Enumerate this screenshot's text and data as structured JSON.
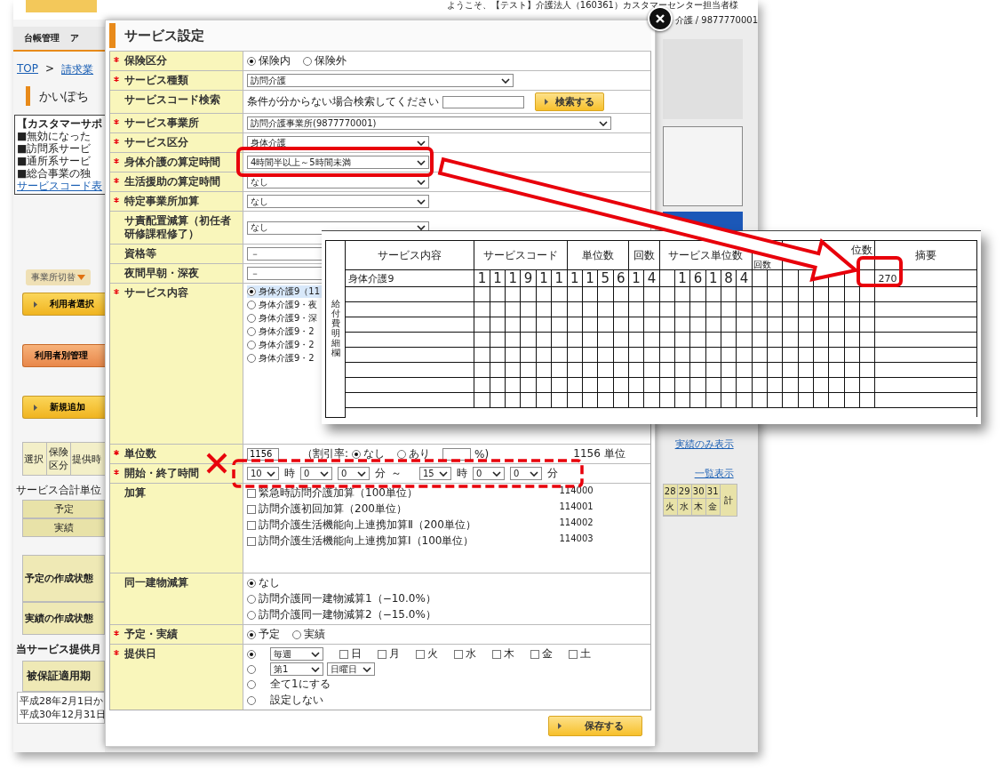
{
  "background": {
    "welcome": "ようこそ、【テスト】介護法人（160361）カスタマーセンター担当者様",
    "account": "介護 / 9877770001",
    "nav_tabs": [
      "台帳管理",
      "ア"
    ],
    "breadcrumb": [
      "TOP",
      "請求業"
    ],
    "breadcrumb_separator": ">",
    "page_title": "かいぽち",
    "notice": {
      "title": "【カスタマーサポ",
      "lines": [
        "■無効になった",
        "■訪問系サービ",
        "■通所系サービ",
        "■総合事業の独"
      ],
      "link": "サービスコード表"
    },
    "office_switch": "事業所切替",
    "buttons": [
      {
        "label": "利用者選択",
        "kind": "primary"
      },
      {
        "label": "利用者別管理",
        "kind": "secondary"
      },
      {
        "label": "新規追加",
        "kind": "primary"
      }
    ],
    "list_headers": [
      "選択",
      "保険区分",
      "提供時"
    ],
    "total_label": "サービス合計単位",
    "total_rows": [
      "予定",
      "実績"
    ],
    "status_rows": [
      "予定の作成状態",
      "実績の作成状態"
    ],
    "period_title": "当サービス提供月",
    "period_header": "被保証適用期",
    "period_lines": [
      "平成28年2月1日か",
      "平成30年12月31日"
    ],
    "links": [
      "実績のみ表示",
      "一覧表示"
    ],
    "calendar": {
      "days": [
        {
          "date": "28",
          "weekday": "火"
        },
        {
          "date": "29",
          "weekday": "水"
        },
        {
          "date": "30",
          "weekday": "木"
        },
        {
          "date": "31",
          "weekday": "金"
        }
      ],
      "total": "計"
    }
  },
  "dialog": {
    "title": "サービス設定",
    "fields": [
      {
        "kind": "radio",
        "label": "保険区分",
        "required": true,
        "options": [
          {
            "label": "保険内",
            "selected": true
          },
          {
            "label": "保険外",
            "selected": false
          }
        ]
      },
      {
        "kind": "select",
        "label": "サービス種類",
        "required": true,
        "value": "訪問介護"
      },
      {
        "kind": "search",
        "label": "サービスコード検索",
        "required": false,
        "hint": "条件が分からない場合検索してください",
        "button": "検索する"
      },
      {
        "kind": "select",
        "label": "サービス事業所",
        "required": true,
        "value": "訪問介護事業所(9877770001)"
      },
      {
        "kind": "select",
        "label": "サービス区分",
        "required": true,
        "value": "身体介護"
      },
      {
        "kind": "select",
        "label": "身体介護の算定時間",
        "required": true,
        "value": "4時間半以上～5時間未満"
      },
      {
        "kind": "select",
        "label": "生活援助の算定時間",
        "required": true,
        "value": "なし"
      },
      {
        "kind": "select",
        "label": "特定事業所加算",
        "required": true,
        "value": "なし"
      },
      {
        "kind": "select",
        "label": "サ責配置減算（初任者研修課程修了）",
        "required": false,
        "value": "なし"
      },
      {
        "kind": "select",
        "label": "資格等",
        "required": false,
        "value": "－"
      },
      {
        "kind": "select",
        "label": "夜間早朝・深夜",
        "required": false,
        "value": "－"
      },
      {
        "kind": "radio_list",
        "label": "サービス内容",
        "required": true,
        "options": [
          {
            "label": "身体介護9（11",
            "selected": true
          },
          {
            "label": "身体介護9・夜",
            "selected": false
          },
          {
            "label": "身体介護9・深",
            "selected": false
          },
          {
            "label": "身体介護9・2",
            "selected": false
          },
          {
            "label": "身体介護9・2",
            "selected": false
          },
          {
            "label": "身体介護9・2",
            "selected": false
          }
        ]
      },
      {
        "kind": "units",
        "label": "単位数",
        "required": true,
        "value": "1156",
        "discount_label": "（割引率:",
        "options": [
          {
            "label": "なし",
            "selected": true
          },
          {
            "label": "あり",
            "selected": false
          }
        ],
        "percent": "%)",
        "total": "1156 単位"
      },
      {
        "kind": "time",
        "label": "開始・終了時間",
        "required": true,
        "start": {
          "hour": "10",
          "hour_unit": "時",
          "minutes": [
            "0",
            "0"
          ],
          "minute_unit": "分"
        },
        "separator": "～",
        "end": {
          "hour": "15",
          "hour_unit": "時",
          "minutes": [
            "0",
            "0"
          ],
          "minute_unit": "分"
        }
      },
      {
        "kind": "checks",
        "label": "加算",
        "required": false,
        "options": [
          {
            "label": "緊急時訪問介護加算（100単位）",
            "code": "114000",
            "checked": false
          },
          {
            "label": "訪問介護初回加算（200単位）",
            "code": "114001",
            "checked": false
          },
          {
            "label": "訪問介護生活機能向上連携加算Ⅱ（200単位）",
            "code": "114002",
            "checked": false
          },
          {
            "label": "訪問介護生活機能向上連携加算Ⅰ（100単位）",
            "code": "114003",
            "checked": false
          }
        ]
      },
      {
        "kind": "radio_list",
        "label": "同一建物減算",
        "required": false,
        "options": [
          {
            "label": "なし",
            "selected": true
          },
          {
            "label": "訪問介護同一建物減算1（−10.0%）",
            "selected": false
          },
          {
            "label": "訪問介護同一建物減算2（−15.0%）",
            "selected": false
          }
        ]
      },
      {
        "kind": "radio",
        "label": "予定・実績",
        "required": true,
        "options": [
          {
            "label": "予定",
            "selected": true
          },
          {
            "label": "実績",
            "selected": false
          }
        ]
      },
      {
        "kind": "schedule",
        "label": "提供日",
        "required": true,
        "modes": [
          {
            "kind": "weekly",
            "selected": true,
            "value": "毎週",
            "days": [
              {
                "label": "日",
                "checked": false
              },
              {
                "label": "月",
                "checked": false
              },
              {
                "label": "火",
                "checked": false
              },
              {
                "label": "水",
                "checked": false
              },
              {
                "label": "木",
                "checked": false
              },
              {
                "label": "金",
                "checked": false
              },
              {
                "label": "土",
                "checked": false
              }
            ]
          },
          {
            "kind": "monthly",
            "selected": false,
            "week": "第1",
            "weekday": "日曜日"
          },
          {
            "kind": "text",
            "selected": false,
            "label": "全て1にする"
          },
          {
            "kind": "text",
            "selected": false,
            "label": "設定しない"
          }
        ]
      }
    ],
    "save_button": "保存する"
  },
  "detail_sheet": {
    "side_label": "給付費明細欄",
    "columns": [
      "サービス内容",
      "サービスコード",
      "単位数",
      "回数",
      "サービス単位数",
      "回数",
      "位数",
      "摘要"
    ],
    "rows": [
      {
        "content": "身体介護9",
        "digits": [
          [
            "1",
            "1",
            "1",
            "9",
            "1",
            "1"
          ],
          [
            "1",
            "1",
            "5",
            "6"
          ],
          [
            "1",
            "4"
          ],
          [
            "1",
            "6",
            "1",
            "8",
            "4"
          ]
        ],
        "summary": "270"
      }
    ]
  }
}
